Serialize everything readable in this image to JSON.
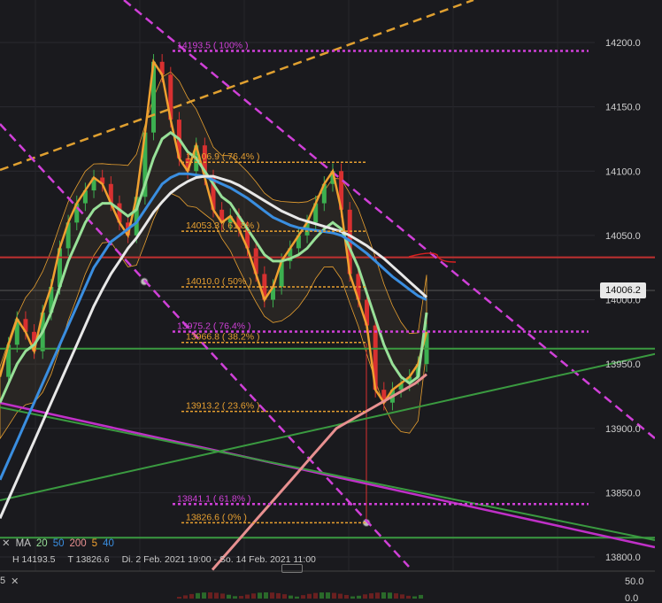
{
  "chart_data": {
    "type": "line",
    "title": "",
    "xlabel": "",
    "ylabel": "",
    "ylim": [
      13793,
      14225
    ],
    "y_ticks": [
      "14200.0",
      "14150.0",
      "14100.0",
      "14050.0",
      "14000.0",
      "13950.0",
      "13900.0",
      "13850.0",
      "13800.0"
    ],
    "y_tick_values": [
      14200,
      14150,
      14100,
      14050,
      14000,
      13950,
      13900,
      13850,
      13800
    ],
    "current_price": "14006.2",
    "current_price_value": 14006.2,
    "fib_levels": [
      {
        "label": "14193.5 ( 100% )",
        "value": 14193.5,
        "color": "#d040d8"
      },
      {
        "label": "14106.9 ( 76.4% )",
        "value": 14106.9,
        "color": "#e8a030"
      },
      {
        "label": "14053.3 ( 61.8% )",
        "value": 14053.3,
        "color": "#e8a030"
      },
      {
        "label": "14010.0 ( 50% )",
        "value": 14010.0,
        "color": "#e8a030"
      },
      {
        "label": "13975.2 ( 76.4% )",
        "value": 13975.2,
        "color": "#d040d8"
      },
      {
        "label": "13966.8 ( 38.2% )",
        "value": 13966.8,
        "color": "#e8a030"
      },
      {
        "label": "13913.2 ( 23.6% )",
        "value": 13913.2,
        "color": "#e8a030"
      },
      {
        "label": "13841.1 ( 61.8% )",
        "value": 13841.1,
        "color": "#d040d8"
      },
      {
        "label": "13826.6 ( 0% )",
        "value": 13826.6,
        "color": "#e8a030"
      }
    ],
    "horizontal_lines": [
      {
        "value": 14033,
        "color": "#c03030"
      },
      {
        "value": 13962,
        "color": "#3a9a40"
      },
      {
        "value": 13815,
        "color": "#3a9a40"
      }
    ],
    "series": [
      {
        "color": "#f0a030",
        "values": [
          13940,
          13965,
          13985,
          13975,
          13960,
          13990,
          14010,
          14040,
          14060,
          14075,
          14085,
          14095,
          14090,
          14075,
          14060,
          14050,
          14080,
          14130,
          14185,
          14175,
          14140,
          14110,
          14100,
          14120,
          14095,
          14070,
          14060,
          14065,
          14055,
          14040,
          14020,
          14000,
          14010,
          14030,
          14040,
          14050,
          14060,
          14075,
          14090,
          14100,
          14070,
          14020,
          14000,
          13980,
          13930,
          13920,
          13930,
          13935,
          13940,
          13950,
          13975
        ]
      },
      {
        "color": "#98e098",
        "values": [
          13920,
          13935,
          13950,
          13960,
          13965,
          13975,
          13990,
          14010,
          14030,
          14045,
          14060,
          14070,
          14075,
          14075,
          14070,
          14065,
          14070,
          14090,
          14110,
          14125,
          14130,
          14125,
          14115,
          14110,
          14100,
          14090,
          14080,
          14075,
          14065,
          14055,
          14045,
          14035,
          14030,
          14030,
          14032,
          14035,
          14040,
          14048,
          14055,
          14060,
          14055,
          14040,
          14025,
          14005,
          13985,
          13965,
          13950,
          13940,
          13935,
          13940,
          13990
        ]
      },
      {
        "color": "#3a8ee0",
        "values": [
          13860,
          13875,
          13890,
          13905,
          13920,
          13935,
          13950,
          13965,
          13980,
          13995,
          14010,
          14025,
          14035,
          14045,
          14050,
          14055,
          14060,
          14070,
          14080,
          14090,
          14095,
          14098,
          14098,
          14097,
          14096,
          14093,
          14090,
          14087,
          14083,
          14079,
          14074,
          14069,
          14064,
          14061,
          14058,
          14056,
          14055,
          14054,
          14053,
          14052,
          14050,
          14046,
          14041,
          14036,
          14030,
          14024,
          14018,
          14013,
          14008,
          14003,
          14000
        ]
      },
      {
        "color": "#e8e8e8",
        "values": [
          13830,
          13845,
          13860,
          13875,
          13890,
          13905,
          13920,
          13935,
          13950,
          13965,
          13980,
          13995,
          14008,
          14020,
          14030,
          14040,
          14048,
          14058,
          14068,
          14076,
          14083,
          14088,
          14092,
          14095,
          14096,
          14096,
          14094,
          14092,
          14089,
          14085,
          14081,
          14077,
          14073,
          14069,
          14066,
          14063,
          14061,
          14059,
          14057,
          14055,
          14053,
          14050,
          14046,
          14042,
          14037,
          14032,
          14026,
          14020,
          14014,
          14008,
          14002
        ]
      },
      {
        "color": "#e89090",
        "values": [
          13790,
          13800,
          13810,
          13820,
          13830,
          13840,
          13850,
          13860,
          13870,
          13880,
          13890,
          13900,
          13905,
          13910,
          13915,
          13920,
          13925,
          13930,
          13935,
          13942
        ]
      }
    ],
    "legend": [
      {
        "label": "20",
        "color": "#98e098"
      },
      {
        "label": "50",
        "color": "#3a8ee0"
      },
      {
        "label": "200",
        "color": "#e89090"
      },
      {
        "label": "5",
        "color": "#f0a030"
      },
      {
        "label": "40",
        "color": "#3a8ee0"
      }
    ],
    "oscillator_ticks": [
      "50.0",
      "0.0"
    ]
  },
  "legend_bar": {
    "ma_label": "MA",
    "periods": [
      {
        "label": "20",
        "color": "#98e098"
      },
      {
        "label": "50",
        "color": "#3a8ee0"
      },
      {
        "label": "200",
        "color": "#e89090"
      },
      {
        "label": "5",
        "color": "#f0a030"
      },
      {
        "label": "40",
        "color": "#3a8ee0"
      }
    ],
    "close_symbol": "✕"
  },
  "range_info": {
    "high": "H 14193.5",
    "low": "T 13826.6",
    "period": "Di. 2 Feb. 2021 19:00 - So. 14 Feb. 2021 11:00"
  },
  "oscillator": {
    "label": "5",
    "close_symbol": "✕"
  }
}
